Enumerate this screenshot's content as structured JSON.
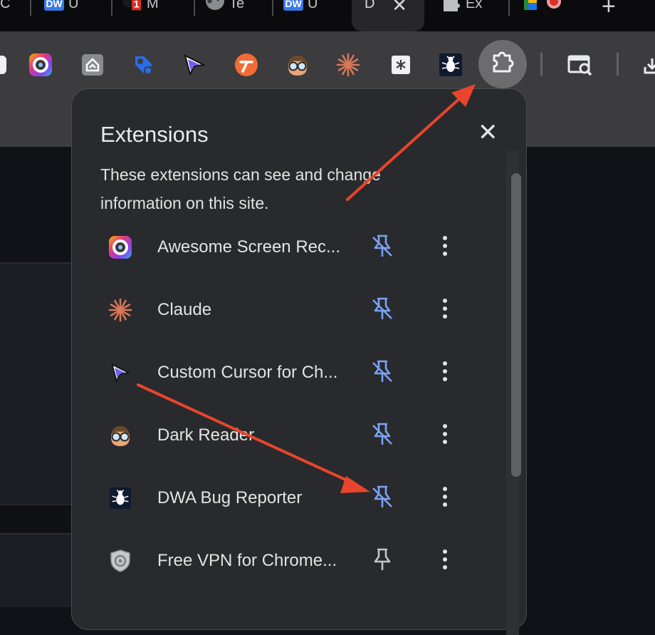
{
  "tabs": [
    {
      "title": "C"
    },
    {
      "title": "U",
      "favicon_text": "DW"
    },
    {
      "title": "M",
      "badge": "1"
    },
    {
      "title": "Te"
    },
    {
      "title": "U",
      "favicon_text": "DW"
    },
    {
      "title": "D",
      "active": true
    },
    {
      "title": "Ex"
    }
  ],
  "toolbar": {
    "icons": [
      "camera-icon",
      "gaia-icon",
      "tag-icon",
      "cursor-icon",
      "t-icon",
      "dark-reader-icon",
      "claude-icon",
      "document-icon",
      "bug-icon"
    ],
    "extensions_button": "puzzle-icon"
  },
  "popup": {
    "title": "Extensions",
    "description": "These extensions can see and change information on this site.",
    "extensions": [
      {
        "name": "Awesome Screen Rec...",
        "icon": "awesome-screen-recorder-icon",
        "pinned": false
      },
      {
        "name": "Claude",
        "icon": "claude-icon",
        "pinned": false
      },
      {
        "name": "Custom Cursor for Ch...",
        "icon": "custom-cursor-icon",
        "pinned": false
      },
      {
        "name": "Dark Reader",
        "icon": "dark-reader-icon",
        "pinned": false
      },
      {
        "name": "DWA Bug Reporter",
        "icon": "bug-icon",
        "pinned": false
      },
      {
        "name": "Free VPN for Chrome...",
        "icon": "vpn-shield-icon",
        "pinned": true
      }
    ]
  },
  "colors": {
    "accent_blue": "#7aa3f5",
    "annotation_arrow": "#e8452c",
    "popup_bg": "#292a2d",
    "toolbar_bg": "#3c3c3e"
  }
}
